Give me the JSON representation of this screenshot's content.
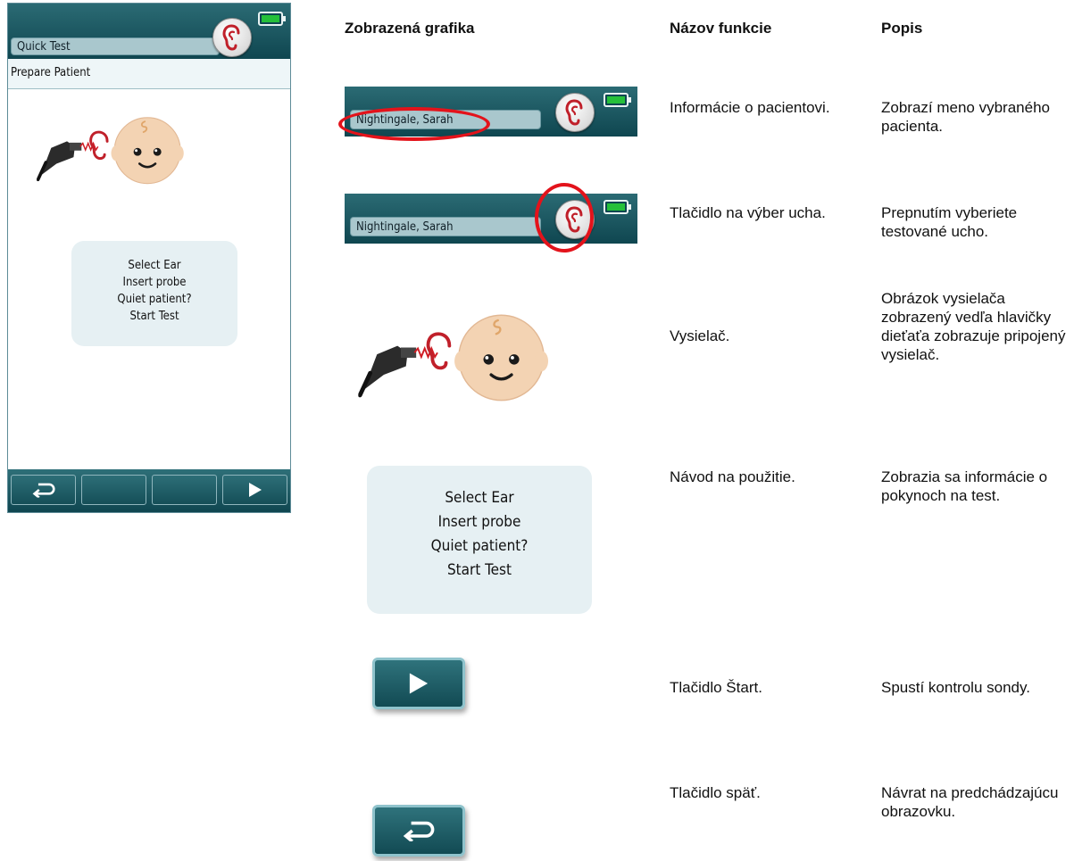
{
  "device": {
    "patient_field": "Quick Test",
    "screen_title": "Prepare Patient",
    "instructions": [
      "Select Ear",
      "Insert probe",
      "Quiet patient?",
      "Start Test"
    ]
  },
  "table": {
    "headers": {
      "graphic": "Zobrazená grafika",
      "function": "Názov funkcie",
      "description": "Popis"
    },
    "rows": [
      {
        "graphic_text": "Nightingale, Sarah",
        "function": "Informácie o pacientovi.",
        "description": "Zobrazí meno vybraného pacienta."
      },
      {
        "graphic_text": "Nightingale, Sarah",
        "function": "Tlačidlo na výber ucha.",
        "description": "Prepnutím vyberiete testované ucho."
      },
      {
        "function": "Vysielač.",
        "description": "Obrázok vysielača zobrazený vedľa hlavičky dieťaťa zobrazuje pripojený vysielač."
      },
      {
        "graphic_lines": [
          "Select Ear",
          "Insert probe",
          "Quiet patient?",
          "Start Test"
        ],
        "function": "Návod na použitie.",
        "description": "Zobrazia sa informácie o pokynoch na test."
      },
      {
        "function": "Tlačidlo Štart.",
        "description": "Spustí kontrolu sondy."
      },
      {
        "function": "Tlačidlo späť.",
        "description": "Návrat na predchádzajúcu obrazovku."
      }
    ]
  },
  "colors": {
    "teal_dark": "#0f4650",
    "teal": "#2b6b74",
    "field": "#a9c7cd",
    "ear_red": "#c0202a",
    "highlight_red": "#e3131b",
    "battery_green": "#25c03a"
  },
  "icons": [
    "ear-icon",
    "battery-icon",
    "probe-icon",
    "baby-face-icon",
    "back-arrow-icon",
    "play-icon"
  ]
}
